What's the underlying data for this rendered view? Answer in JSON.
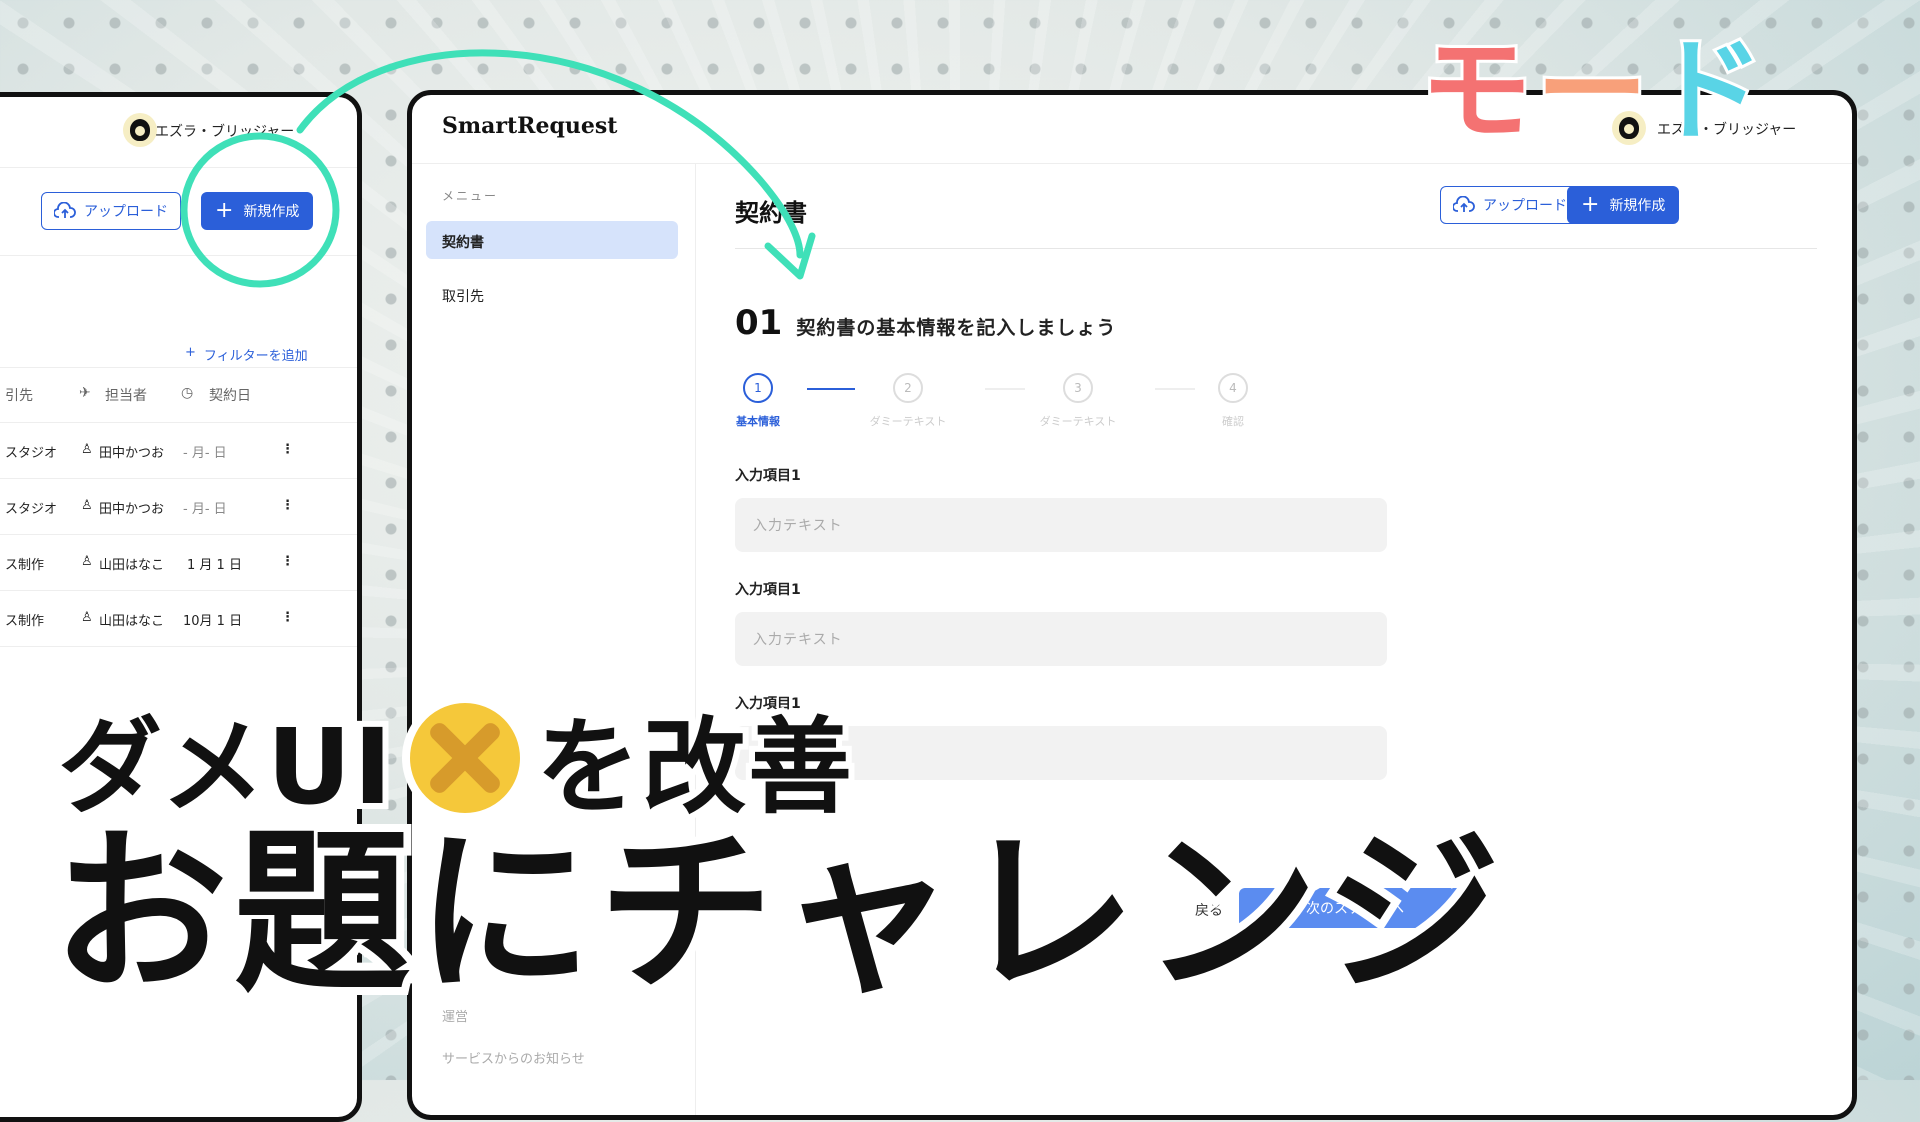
{
  "left_window": {
    "user_name": "エズラ・ブリッジャー",
    "partial_button": "成",
    "upload_label": "アップロード",
    "new_label": "新規作成",
    "filter_label": "フィルターを追加",
    "columns": [
      "引先",
      "担当者",
      "契約日"
    ],
    "rows": [
      {
        "client": "スタジオ",
        "person": "田中かつお",
        "date": "-  月-  日"
      },
      {
        "client": "スタジオ",
        "person": "田中かつお",
        "date": "-  月-  日"
      },
      {
        "client": "ス制作",
        "person": "山田はなこ",
        "date": "1 月 1 日"
      },
      {
        "client": "ス制作",
        "person": "山田はなこ",
        "date": "10月 1 日"
      }
    ],
    "kebab": "⋮"
  },
  "main_window": {
    "brand": "SmartRequest",
    "user_name": "エズラ・ブリッジャー",
    "menu_label": "メニュー",
    "sidebar_items": [
      {
        "label": "契約書"
      },
      {
        "label": "取引先"
      }
    ],
    "footer_items": [
      "運営",
      "サービスからのお知らせ"
    ],
    "page_title": "契約書",
    "upload_label": "アップロード",
    "new_label": "新規作成",
    "step_number": "01",
    "step_heading": "契約書の基本情報を記入しましょう",
    "steps": [
      {
        "num": "1",
        "label": "基本情報"
      },
      {
        "num": "2",
        "label": "ダミーテキスト"
      },
      {
        "num": "3",
        "label": "ダミーテキスト"
      },
      {
        "num": "4",
        "label": "確認"
      }
    ],
    "fields": [
      {
        "label": "入力項目1",
        "placeholder": "入力テキスト"
      },
      {
        "label": "入力項目1",
        "placeholder": "入力テキスト"
      },
      {
        "label": "入力項目1",
        "placeholder": "入力テキスト"
      }
    ],
    "back_label": "戻る",
    "next_label": "次のステップへ"
  },
  "overlay": {
    "mode_text_1": "モ",
    "mode_text_2": "ー",
    "mode_text_3": "ド",
    "caption_line1_a": "ダメUI",
    "caption_line1_b": "を改善",
    "caption_line2": "お題にチャレンジ",
    "emoji_icon": "no-gesture-emoji",
    "colors": {
      "accent": "#2b5fd9",
      "arrow": "#3fe0b8",
      "mode_pink": "#f47272",
      "mode_cyan": "#59d4e6"
    }
  }
}
